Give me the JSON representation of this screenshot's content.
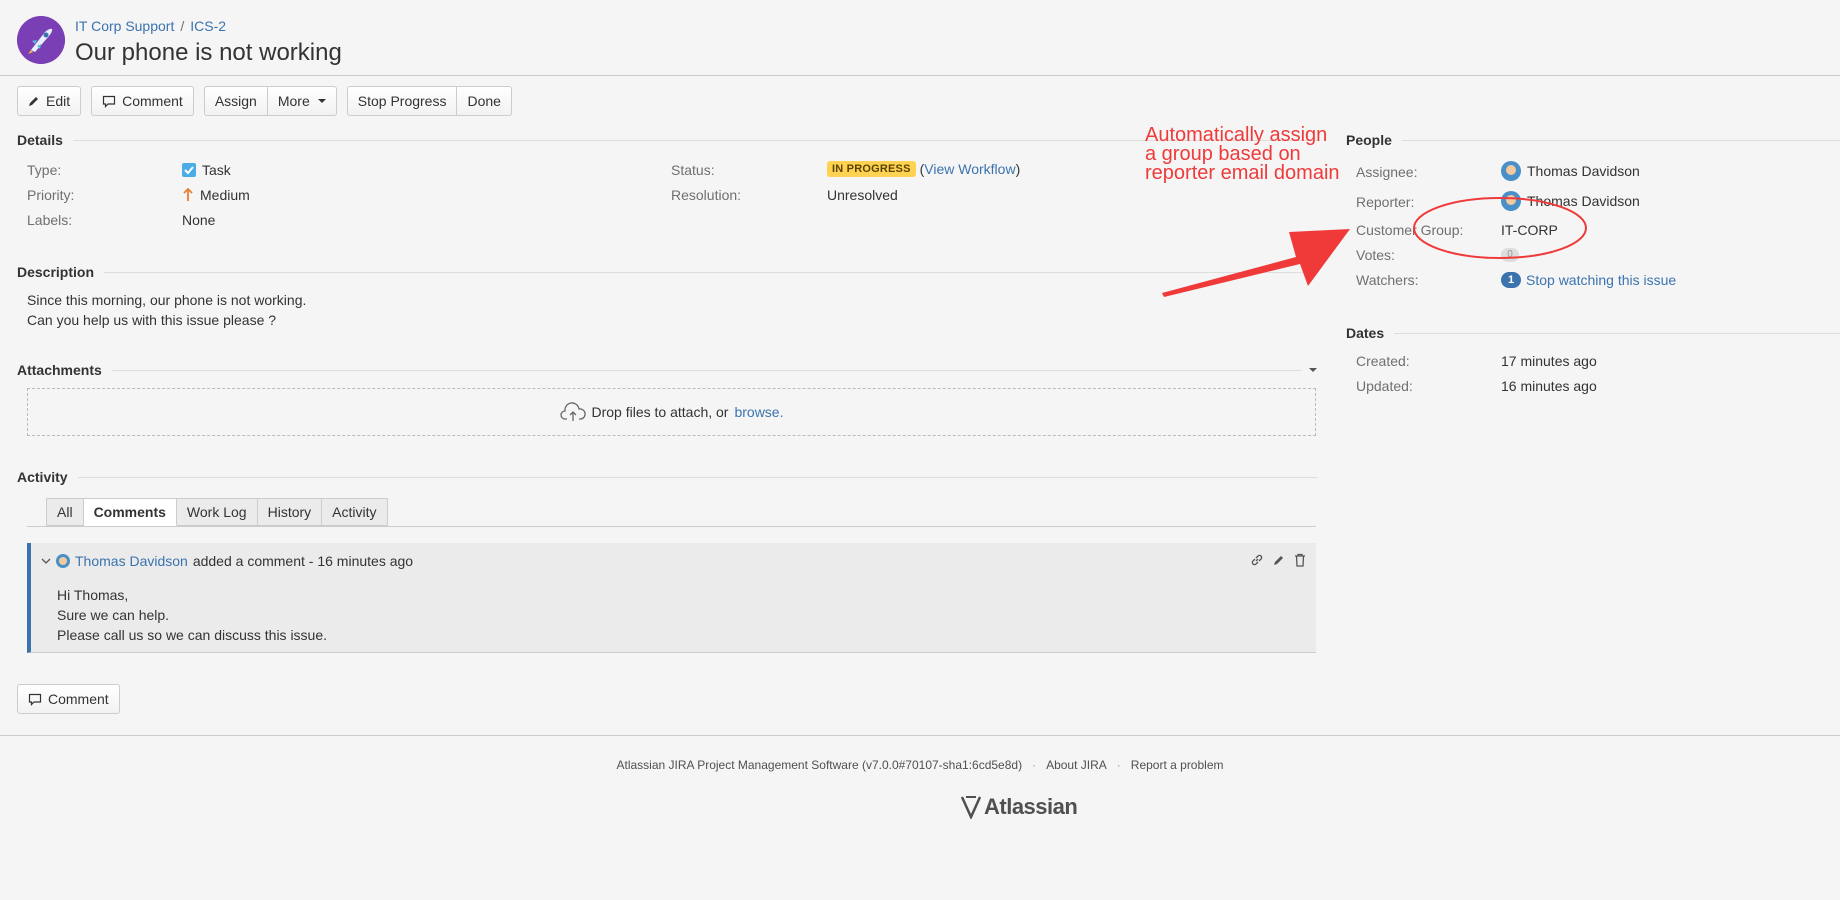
{
  "header": {
    "project": "IT Corp Support",
    "separator": "/",
    "issue_key": "ICS-2",
    "title": "Our phone is not working"
  },
  "toolbar": {
    "edit": "Edit",
    "comment": "Comment",
    "assign": "Assign",
    "more": "More",
    "stop_progress": "Stop Progress",
    "done": "Done"
  },
  "details": {
    "heading": "Details",
    "type_label": "Type:",
    "type_value": "Task",
    "priority_label": "Priority:",
    "priority_value": "Medium",
    "labels_label": "Labels:",
    "labels_value": "None",
    "status_label": "Status:",
    "status_value": "IN PROGRESS",
    "view_workflow": "View Workflow",
    "resolution_label": "Resolution:",
    "resolution_value": "Unresolved"
  },
  "description": {
    "heading": "Description",
    "line1": "Since this morning, our phone is not working.",
    "line2": "Can you help us with this issue please ?"
  },
  "attachments": {
    "heading": "Attachments",
    "drop_text": "Drop files to attach, or",
    "browse": "browse."
  },
  "activity": {
    "heading": "Activity",
    "tabs": [
      "All",
      "Comments",
      "Work Log",
      "History",
      "Activity"
    ],
    "active_tab": "Comments",
    "comment": {
      "author": "Thomas Davidson",
      "meta": "added a comment - 16 minutes ago",
      "line1": "Hi Thomas,",
      "line2": "Sure we can help.",
      "line3": "Please call us so we can discuss this issue."
    },
    "comment_button": "Comment"
  },
  "people": {
    "heading": "People",
    "assignee_label": "Assignee:",
    "assignee_value": "Thomas Davidson",
    "reporter_label": "Reporter:",
    "reporter_value": "Thomas Davidson",
    "group_label": "Customer Group:",
    "group_value": "IT-CORP",
    "votes_label": "Votes:",
    "votes_value": "0",
    "watchers_label": "Watchers:",
    "watchers_count": "1",
    "watch_link": "Stop watching this issue"
  },
  "dates": {
    "heading": "Dates",
    "created_label": "Created:",
    "created_value": "17 minutes ago",
    "updated_label": "Updated:",
    "updated_value": "16 minutes ago"
  },
  "annotation": {
    "text": "Automatically assign\na group based on\nreporter email domain",
    "color": "#f03a3a"
  },
  "footer": {
    "software": "Atlassian JIRA Project Management Software (v7.0.0#70107-sha1:6cd5e8d)",
    "about": "About JIRA",
    "report": "Report a problem",
    "logo": "Atlassian"
  },
  "colors": {
    "link": "#3b73af",
    "status_badge": "#ffd351",
    "annotation": "#f03a3a"
  }
}
